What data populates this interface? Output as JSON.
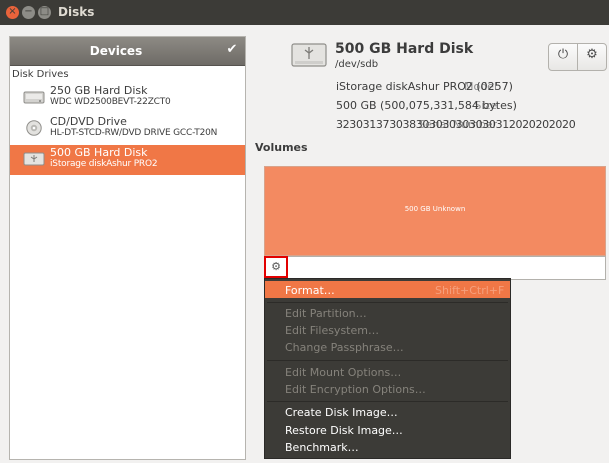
{
  "window": {
    "title": "Disks",
    "close_glyph": "×",
    "minimize_glyph": "−",
    "maximize_glyph": "□"
  },
  "sidebar": {
    "header": "Devices",
    "check_glyph": "✔",
    "group_label": "Disk Drives",
    "drives": [
      {
        "name": "250 GB Hard Disk",
        "detail": "WDC WD2500BEVT-22ZCT0",
        "icon": "hard-disk-icon",
        "selected": false
      },
      {
        "name": "CD/DVD Drive",
        "detail": "HL-DT-STCD-RW/DVD DRIVE GCC-T20N",
        "icon": "optical-drive-icon",
        "selected": false
      },
      {
        "name": "500 GB Hard Disk",
        "detail": "iStorage diskAshur PRO2",
        "icon": "usb-disk-icon",
        "selected": true
      }
    ]
  },
  "disk": {
    "title": "500 GB Hard Disk",
    "device": "/dev/sdb",
    "power_glyph": "⏻",
    "gear_glyph": "⚙",
    "properties": [
      {
        "key": "Model",
        "value": "iStorage diskAshur PRO2 (0257)"
      },
      {
        "key": "Size",
        "value": "500 GB (500,075,331,584 bytes)"
      },
      {
        "key": "Serial Number",
        "value": "323031373038303030303030312020202020"
      }
    ]
  },
  "volumes": {
    "heading": "Volumes",
    "partition_label": "500 GB Unknown",
    "gear_glyph": "⚙"
  },
  "menu": {
    "items": [
      {
        "label": "Format…",
        "accel": "Shift+Ctrl+F",
        "enabled": true,
        "highlighted": true
      },
      {
        "label": "Edit Partition…",
        "enabled": false
      },
      {
        "label": "Edit Filesystem…",
        "enabled": false
      },
      {
        "label": "Change Passphrase…",
        "enabled": false
      },
      {
        "label": "Edit Mount Options…",
        "enabled": false
      },
      {
        "label": "Edit Encryption Options…",
        "enabled": false
      },
      {
        "label": "Create Disk Image…",
        "enabled": true
      },
      {
        "label": "Restore Disk Image…",
        "enabled": true
      },
      {
        "label": "Benchmark…",
        "enabled": true
      }
    ]
  },
  "colors": {
    "accent": "#f07746",
    "titlebar": "#3c3b37",
    "partition": "#f38a61",
    "menu_bg": "#3c3b37",
    "annotation": "#e20000"
  }
}
